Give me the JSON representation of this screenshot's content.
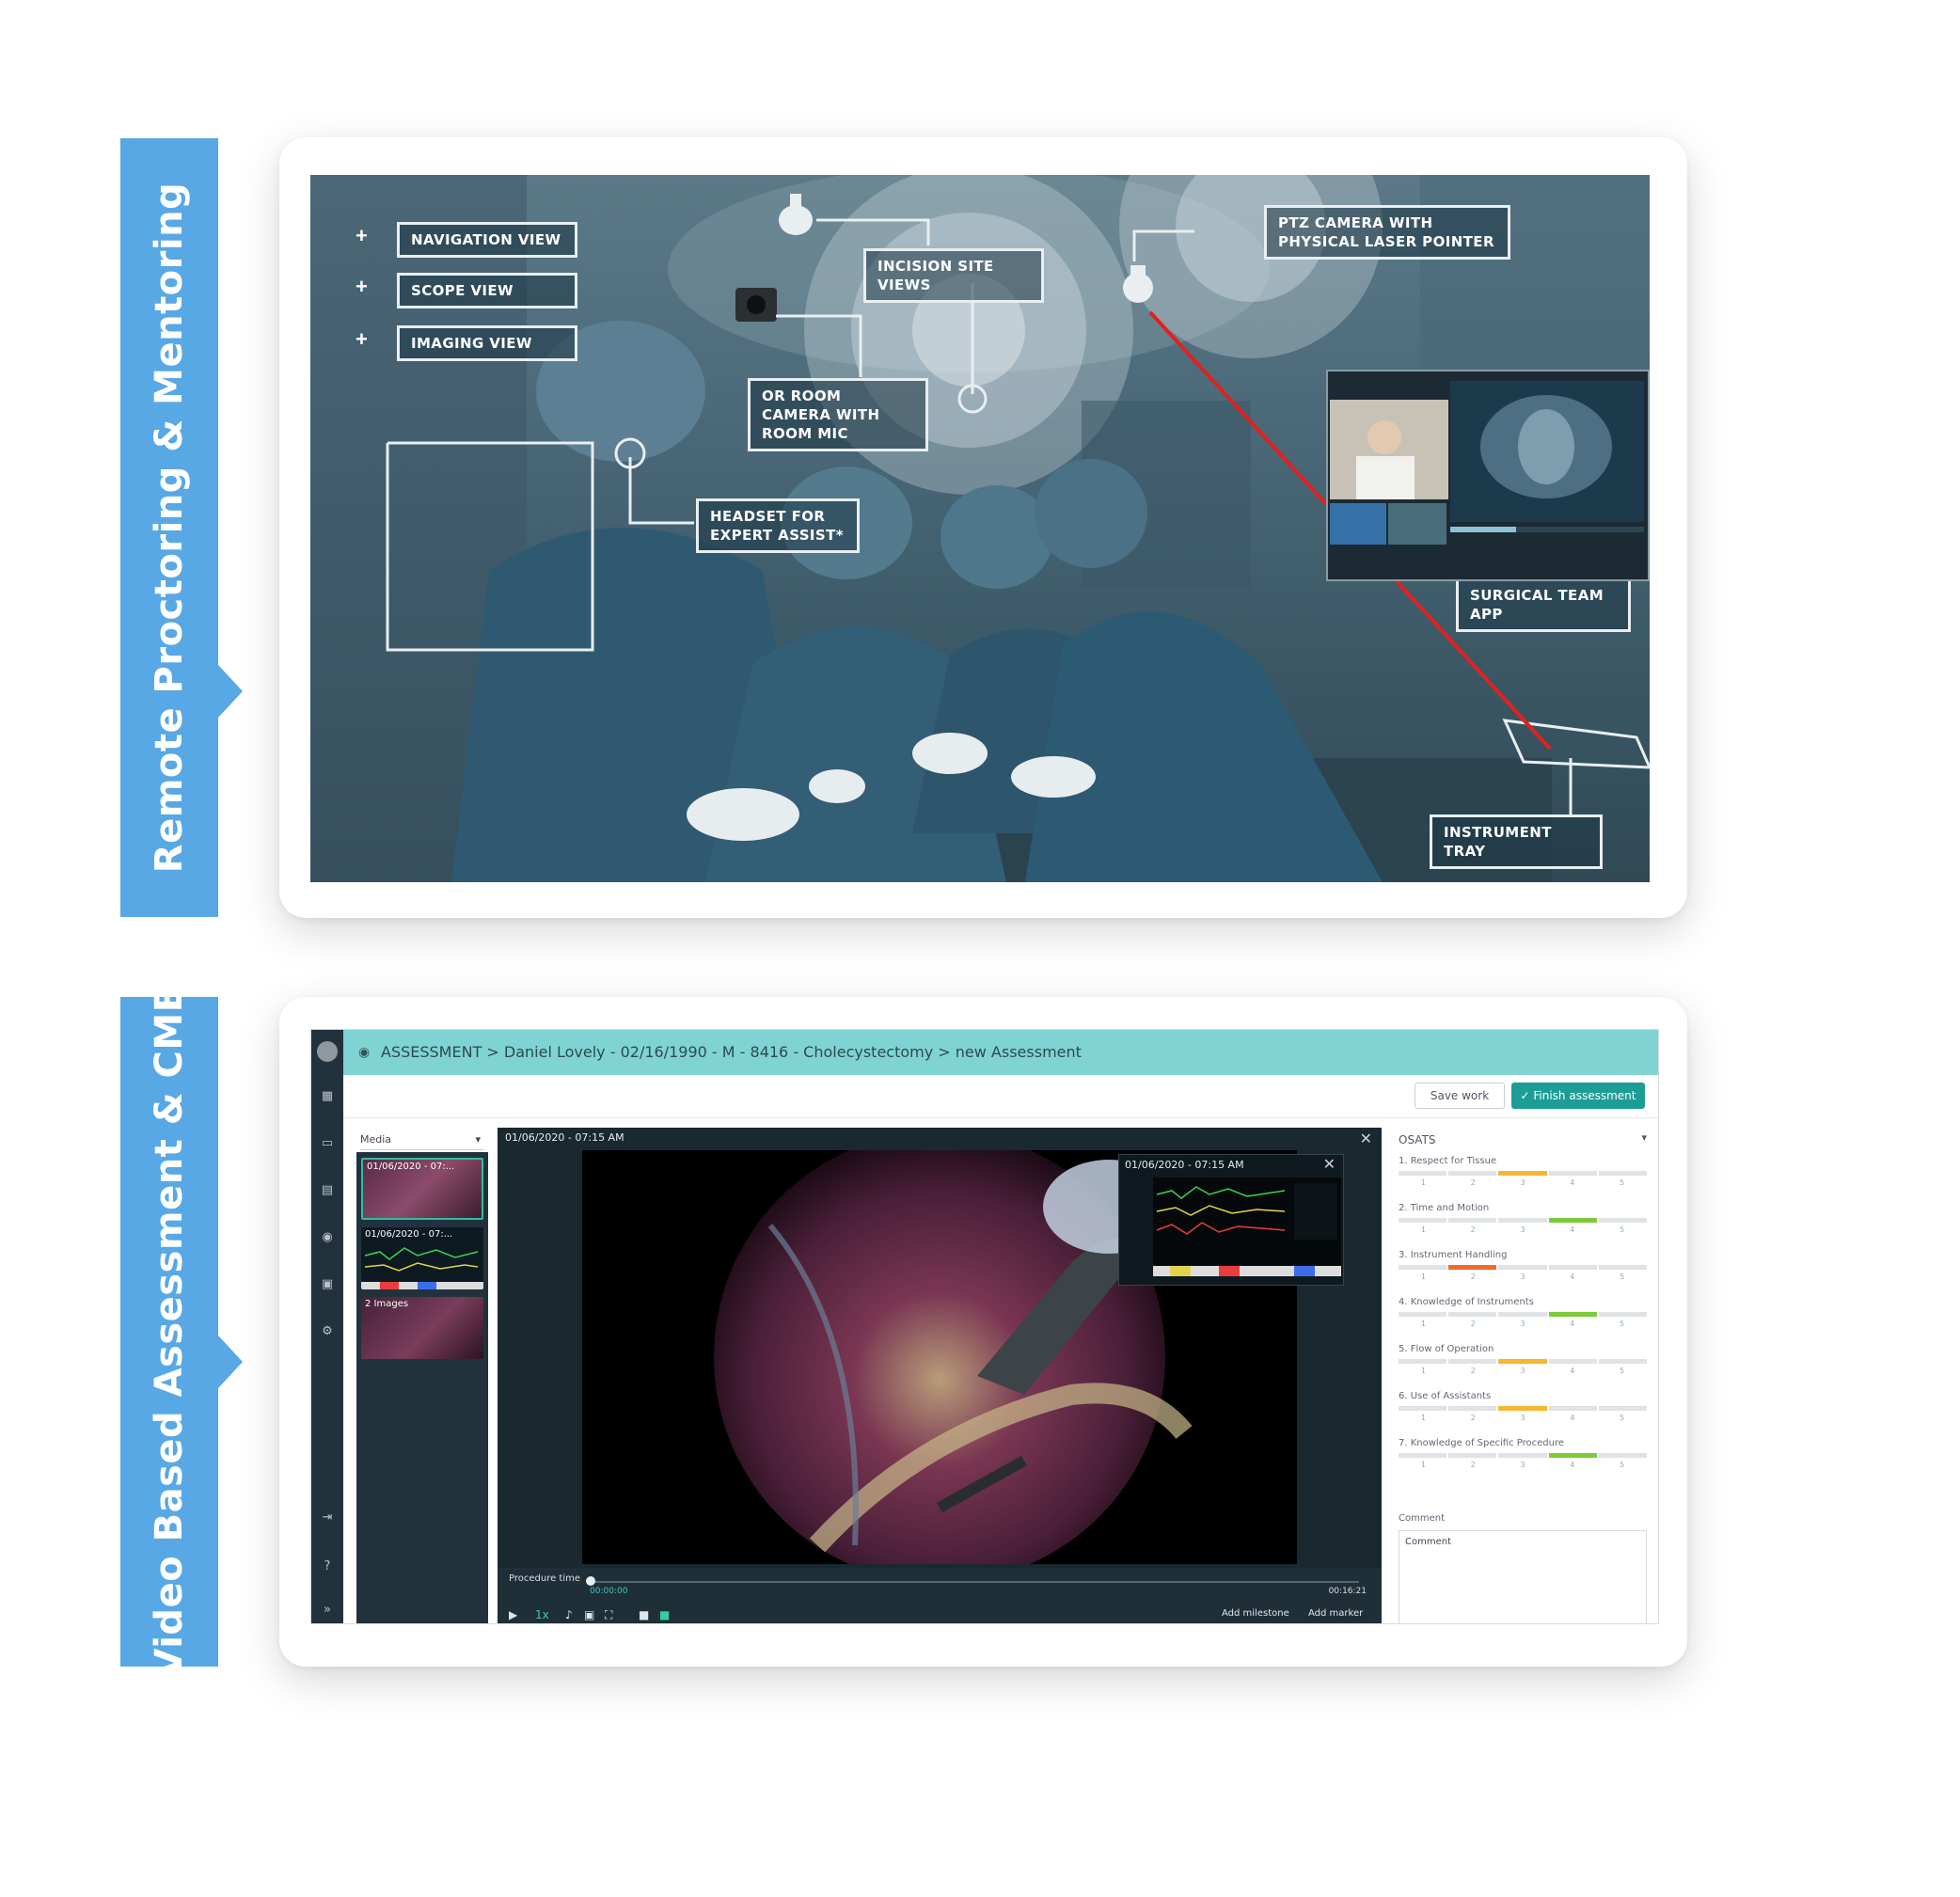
{
  "tabs": {
    "proctoring": "Remote Proctoring & Mentoring",
    "assessment": "Video Based Assessment & CME"
  },
  "or_scene": {
    "labels": {
      "navigation_view": "NAVIGATION VIEW",
      "scope_view": "SCOPE VIEW",
      "imaging_view": "IMAGING VIEW",
      "incision_site_views": "INCISION SITE VIEWS",
      "ptz_camera": "PTZ CAMERA WITH PHYSICAL LASER POINTER",
      "or_room_camera": "OR ROOM CAMERA WITH ROOM MIC",
      "headset": "HEADSET FOR EXPERT ASSIST*",
      "surgical_team_app": "SURGICAL TEAM APP",
      "instrument_tray": "INSTRUMENT TRAY"
    },
    "plus": "+"
  },
  "assessment_app": {
    "breadcrumb": "ASSESSMENT > Daniel Lovely - 02/16/1990 - M - 8416 - Cholecystectomy > new Assessment",
    "save_button": "Save work",
    "finish_button": "✓ Finish assessment",
    "media": {
      "header": "Media",
      "items": [
        {
          "label": "01/06/2020 - 07:..."
        },
        {
          "label": "01/06/2020 - 07:..."
        },
        {
          "label": "2 Images"
        }
      ]
    },
    "player": {
      "title": "01/06/2020 - 07:15 AM",
      "vitals_title": "01/06/2020 - 07:15 AM",
      "timeline_label": "Procedure time",
      "time_start": "00:00:00",
      "time_end": "00:16:21",
      "speed": "1x",
      "add_milestone": "Add milestone",
      "add_marker": "Add marker"
    },
    "osats": {
      "header": "OSATS",
      "criteria": [
        {
          "title": "1. Respect for Tissue",
          "score": 3,
          "color": "#f5b731"
        },
        {
          "title": "2. Time and Motion",
          "score": 4,
          "color": "#7ccb3a"
        },
        {
          "title": "3. Instrument Handling",
          "score": 2,
          "color": "#ef6a2d"
        },
        {
          "title": "4. Knowledge of Instruments",
          "score": 4,
          "color": "#7ccb3a"
        },
        {
          "title": "5. Flow of Operation",
          "score": 3,
          "color": "#f5b731"
        },
        {
          "title": "6. Use of Assistants",
          "score": 3,
          "color": "#f5b731"
        },
        {
          "title": "7. Knowledge of Specific Procedure",
          "score": 4,
          "color": "#7ccb3a"
        }
      ],
      "scale": [
        "1",
        "2",
        "3",
        "4",
        "5"
      ],
      "comment_label": "Comment",
      "comment_value": "Comment"
    }
  },
  "colors": {
    "tab_blue": "#58a8e6",
    "header_teal": "#7fd4d3",
    "finish_teal": "#1c9e96",
    "laser_red": "#e0221e"
  }
}
